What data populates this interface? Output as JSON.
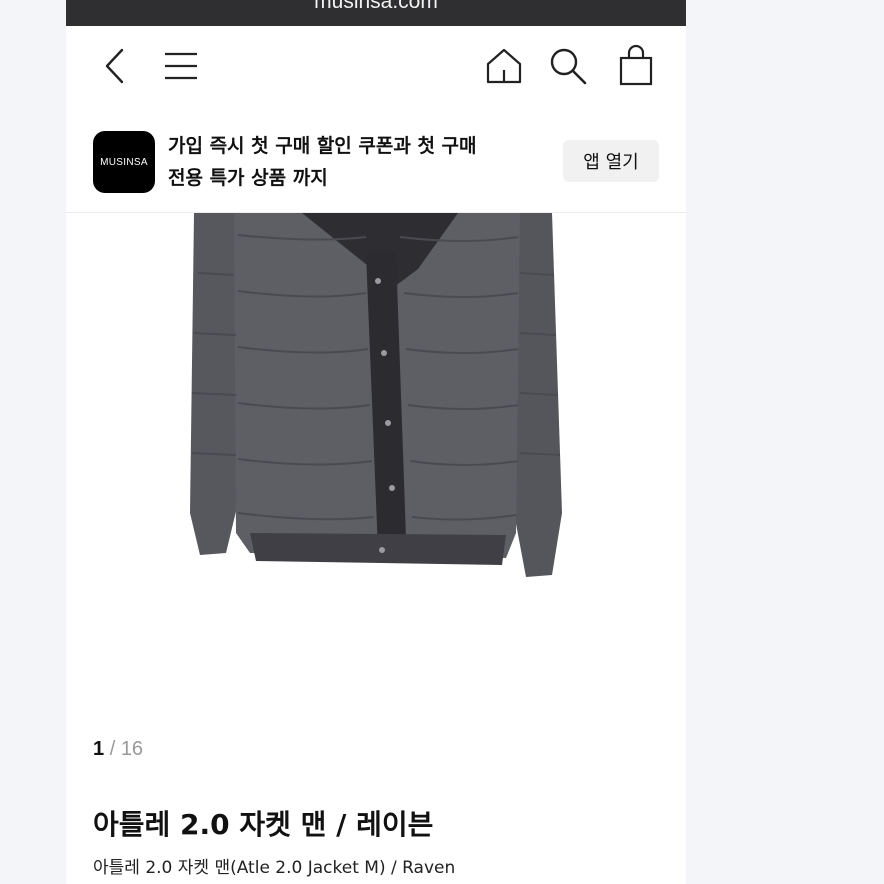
{
  "browser": {
    "url": "musinsa.com"
  },
  "nav": {
    "icons": [
      "back-icon",
      "menu-icon",
      "home-icon",
      "search-icon",
      "shopping-bag-icon"
    ]
  },
  "app_banner": {
    "logo_text": "MUSINSA",
    "line1": "가입 즉시 첫 구매 할인 쿠폰과 첫 구매",
    "line2": "전용 특가 상품 까지",
    "open_app_label": "앱 열기"
  },
  "gallery": {
    "current": "1",
    "separator": "/",
    "total": "16"
  },
  "product": {
    "title": "아틀레 2.0 자켓 맨 / 레이븐",
    "subtitle": "아틀레 2.0 자켓 맨(Atle 2.0 Jacket M) / Raven"
  },
  "colors": {
    "jacket": "#5c5c63",
    "placket": "#2b2b30",
    "url_bar": "#2f2f31"
  }
}
